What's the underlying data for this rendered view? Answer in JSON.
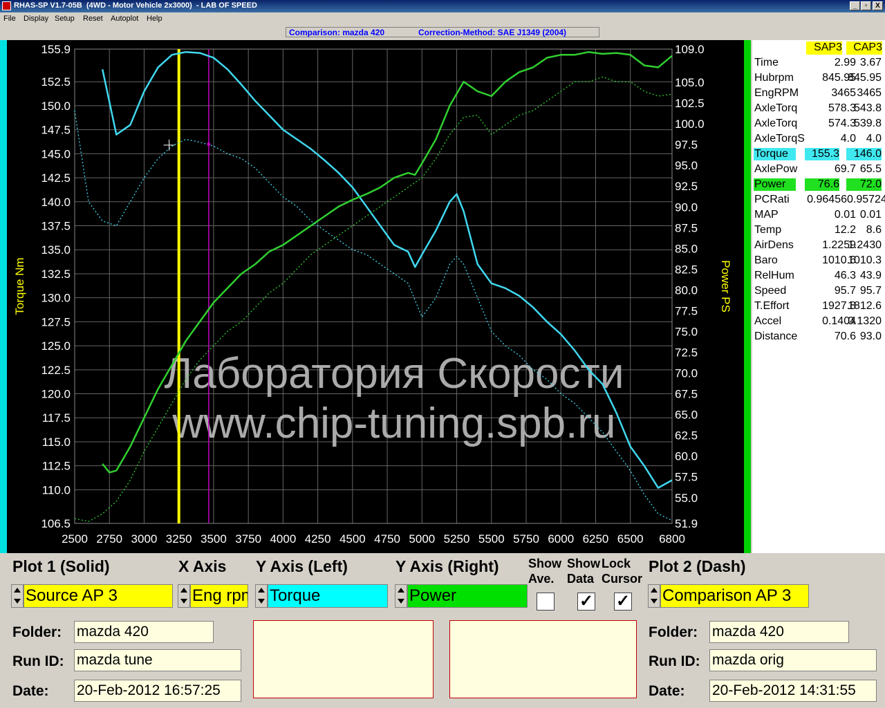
{
  "window": {
    "title": "RHAS-SP V1.7-05B  (4WD - Motor Vehicle 2x3000)  - LAB OF SPEED",
    "min": "_",
    "max": "▫",
    "close": "X"
  },
  "menu": [
    "File",
    "Display",
    "Setup",
    "Reset",
    "Autoplot",
    "Help"
  ],
  "status": {
    "comparison": "Comparison: mazda 420",
    "correction": "Correction-Method: SAE J1349 (2004)"
  },
  "watermark": {
    "line1": "Лаборатория Скорости",
    "line2": "www.chip-tuning.spb.ru"
  },
  "chart_data": {
    "type": "line",
    "xlabel": "",
    "ylabel_left": "Torque Nm",
    "ylabel_right": "Power PS",
    "xlim": [
      2500,
      6800
    ],
    "ylim_left": [
      106.5,
      155.9
    ],
    "ylim_right": [
      51.9,
      109.0
    ],
    "x_ticks": [
      "2500",
      "2750",
      "3000",
      "3250",
      "3500",
      "3750",
      "4000",
      "4250",
      "4500",
      "4750",
      "5000",
      "5250",
      "5500",
      "5750",
      "6000",
      "6250",
      "6500",
      "6800"
    ],
    "y_left_ticks": [
      "155.9",
      "152.5",
      "150.0",
      "147.5",
      "145.0",
      "142.5",
      "140.0",
      "137.5",
      "135.0",
      "132.5",
      "130.0",
      "127.5",
      "125.0",
      "122.5",
      "120.0",
      "117.5",
      "115.0",
      "112.5",
      "110.0",
      "106.5"
    ],
    "y_right_ticks": [
      "109.0",
      "105.0",
      "102.5",
      "100.0",
      "97.5",
      "95.0",
      "92.5",
      "90.0",
      "87.5",
      "85.0",
      "82.5",
      "80.0",
      "77.5",
      "75.0",
      "72.5",
      "70.0",
      "67.5",
      "65.0",
      "62.5",
      "60.0",
      "57.5",
      "55.0",
      "51.9"
    ],
    "grid": true,
    "cursor_x": 3250,
    "compare_cursor_x": 3465,
    "colors": {
      "torque": "#40d8f0",
      "power": "#30d030",
      "cursor": "#ffff00",
      "cursor2": "#c000c0"
    },
    "series": [
      {
        "name": "Torque",
        "style": "solid",
        "axis": "left",
        "x": [
          2700,
          2800,
          2900,
          3000,
          3100,
          3200,
          3300,
          3400,
          3500,
          3600,
          3700,
          3800,
          3900,
          4000,
          4100,
          4200,
          4300,
          4400,
          4500,
          4600,
          4700,
          4800,
          4900,
          4950,
          5000,
          5100,
          5200,
          5250,
          5300,
          5400,
          5500,
          5600,
          5700,
          5800,
          5900,
          6000,
          6100,
          6200,
          6300,
          6400,
          6500,
          6600,
          6700,
          6800
        ],
        "y": [
          153.8,
          147.0,
          148.0,
          151.5,
          154.0,
          155.3,
          155.6,
          155.5,
          155.0,
          153.8,
          152.2,
          150.5,
          149.0,
          147.5,
          146.5,
          145.5,
          144.3,
          143.0,
          141.5,
          139.5,
          137.5,
          135.5,
          134.8,
          133.2,
          134.5,
          137.0,
          140.0,
          140.8,
          139.0,
          133.5,
          131.5,
          131.0,
          130.2,
          129.0,
          127.5,
          126.2,
          124.5,
          122.5,
          121.0,
          118.0,
          114.5,
          112.5,
          110.2,
          111.0
        ]
      },
      {
        "name": "Power",
        "style": "solid",
        "axis": "left",
        "x": [
          2700,
          2750,
          2800,
          2900,
          3000,
          3100,
          3200,
          3300,
          3400,
          3500,
          3600,
          3700,
          3800,
          3900,
          4000,
          4100,
          4200,
          4300,
          4400,
          4500,
          4600,
          4700,
          4800,
          4900,
          4950,
          5000,
          5100,
          5200,
          5300,
          5400,
          5500,
          5600,
          5700,
          5800,
          5900,
          6000,
          6100,
          6200,
          6300,
          6400,
          6500,
          6600,
          6700,
          6800
        ],
        "y": [
          112.7,
          111.8,
          112.0,
          114.5,
          117.5,
          120.5,
          123.0,
          125.5,
          127.5,
          129.5,
          131.0,
          132.5,
          133.5,
          134.8,
          135.5,
          136.5,
          137.5,
          138.5,
          139.5,
          140.2,
          140.8,
          141.5,
          142.5,
          143.0,
          142.8,
          144.0,
          146.5,
          150.0,
          152.5,
          151.5,
          151.0,
          152.5,
          153.5,
          154.0,
          155.0,
          155.3,
          155.3,
          155.6,
          155.4,
          155.5,
          155.3,
          154.2,
          154.0,
          155.2
        ]
      },
      {
        "name": "Torque",
        "style": "dash",
        "axis": "left",
        "x": [
          2500,
          2600,
          2700,
          2800,
          2900,
          3000,
          3100,
          3200,
          3300,
          3400,
          3500,
          3600,
          3700,
          3800,
          3900,
          4000,
          4100,
          4200,
          4300,
          4400,
          4500,
          4600,
          4700,
          4800,
          4900,
          5000,
          5100,
          5200,
          5250,
          5300,
          5400,
          5500,
          5600,
          5700,
          5800,
          5900,
          6000,
          6100,
          6200,
          6300,
          6400,
          6500,
          6600,
          6700,
          6800
        ],
        "y": [
          149.5,
          140.0,
          138.0,
          137.5,
          140.0,
          142.5,
          144.5,
          145.8,
          146.5,
          146.2,
          145.8,
          145.0,
          144.5,
          143.5,
          142.0,
          140.5,
          139.5,
          138.0,
          137.0,
          136.0,
          135.0,
          134.5,
          133.5,
          132.5,
          131.5,
          128.0,
          130.0,
          133.5,
          134.3,
          133.5,
          130.0,
          126.5,
          125.0,
          124.0,
          122.5,
          121.5,
          120.0,
          119.0,
          117.5,
          116.0,
          114.0,
          112.0,
          109.5,
          107.5,
          106.8
        ]
      },
      {
        "name": "Power",
        "style": "dash",
        "axis": "left",
        "x": [
          2500,
          2600,
          2700,
          2800,
          2900,
          3000,
          3100,
          3200,
          3300,
          3400,
          3500,
          3600,
          3700,
          3800,
          3900,
          4000,
          4100,
          4200,
          4300,
          4400,
          4500,
          4600,
          4700,
          4800,
          4900,
          5000,
          5100,
          5200,
          5300,
          5400,
          5500,
          5600,
          5700,
          5800,
          5900,
          6000,
          6100,
          6200,
          6300,
          6400,
          6500,
          6600,
          6700,
          6800
        ],
        "y": [
          107.0,
          106.7,
          107.5,
          108.8,
          111.0,
          114.0,
          116.5,
          119.0,
          121.5,
          123.5,
          125.0,
          126.5,
          127.5,
          129.0,
          130.5,
          131.5,
          133.0,
          134.5,
          135.5,
          136.5,
          137.5,
          138.5,
          139.5,
          140.5,
          141.5,
          142.5,
          144.5,
          147.0,
          148.8,
          149.0,
          147.0,
          148.0,
          149.0,
          149.5,
          150.5,
          151.5,
          152.5,
          152.5,
          153.0,
          152.5,
          152.5,
          151.5,
          151.0,
          151.2
        ]
      }
    ]
  },
  "table": {
    "headers": [
      "",
      "SAP3",
      "CAP3"
    ],
    "rows": [
      {
        "name": "Time",
        "a": "2.99",
        "b": "3.67"
      },
      {
        "name": "Hubrpm",
        "a": "845.95",
        "b": "845.95"
      },
      {
        "name": "EngRPM",
        "a": "3465",
        "b": "3465"
      },
      {
        "name": "AxleTorq",
        "a": "578.3",
        "b": "543.8"
      },
      {
        "name": "AxleTorq",
        "a": "574.3",
        "b": "539.8"
      },
      {
        "name": "AxleTorqS",
        "a": "4.0",
        "b": "4.0"
      },
      {
        "name": "Torque",
        "a": "155.3",
        "b": "146.0",
        "hl": "#40e8f0"
      },
      {
        "name": "AxlePow",
        "a": "69.7",
        "b": "65.5"
      },
      {
        "name": "Power",
        "a": "76.6",
        "b": "72.0",
        "hl": "#20e020"
      },
      {
        "name": "PCRati",
        "a": "0.96456",
        "b": "0.95724"
      },
      {
        "name": "MAP",
        "a": "0.01",
        "b": "0.01"
      },
      {
        "name": "Temp",
        "a": "12.2",
        "b": "8.6"
      },
      {
        "name": "AirDens",
        "a": "1.2259",
        "b": "1.2430"
      },
      {
        "name": "Baro",
        "a": "1010.6",
        "b": "1010.3"
      },
      {
        "name": "RelHum",
        "a": "46.3",
        "b": "43.9"
      },
      {
        "name": "Speed",
        "a": "95.7",
        "b": "95.7"
      },
      {
        "name": "T.Effort",
        "a": "1927.8",
        "b": "1812.6"
      },
      {
        "name": "Accel",
        "a": "0.1404",
        "b": "0.1320"
      },
      {
        "name": "Distance",
        "a": "70.6",
        "b": "93.0"
      }
    ]
  },
  "controls": {
    "plot1_label": "Plot 1 (Solid)",
    "xaxis_label": "X Axis",
    "yleft_label": "Y Axis (Left)",
    "yright_label": "Y Axis (Right)",
    "show_ave": [
      "Show",
      "Ave."
    ],
    "show_data": [
      "Show",
      "Data"
    ],
    "lock_cursor": [
      "Lock",
      "Cursor"
    ],
    "plot2_label": "Plot 2 (Dash)",
    "plot1_value": "Source AP 3",
    "xaxis_value": "Eng rpm",
    "yleft_value": "Torque",
    "yright_value": "Power",
    "plot2_value": "Comparison AP 3",
    "check_mark": "✓",
    "colors": {
      "yellow": "#ffff00",
      "cyan": "#00ffff",
      "green": "#00e000"
    }
  },
  "run1": {
    "folder_label": "Folder:",
    "folder": "mazda 420",
    "runid_label": "Run ID:",
    "runid": "mazda tune",
    "date_label": "Date:",
    "date": "20-Feb-2012  16:57:25"
  },
  "run2": {
    "folder_label": "Folder:",
    "folder": "mazda 420",
    "runid_label": "Run ID:",
    "runid": "mazda orig",
    "date_label": "Date:",
    "date": "20-Feb-2012  14:31:55"
  }
}
